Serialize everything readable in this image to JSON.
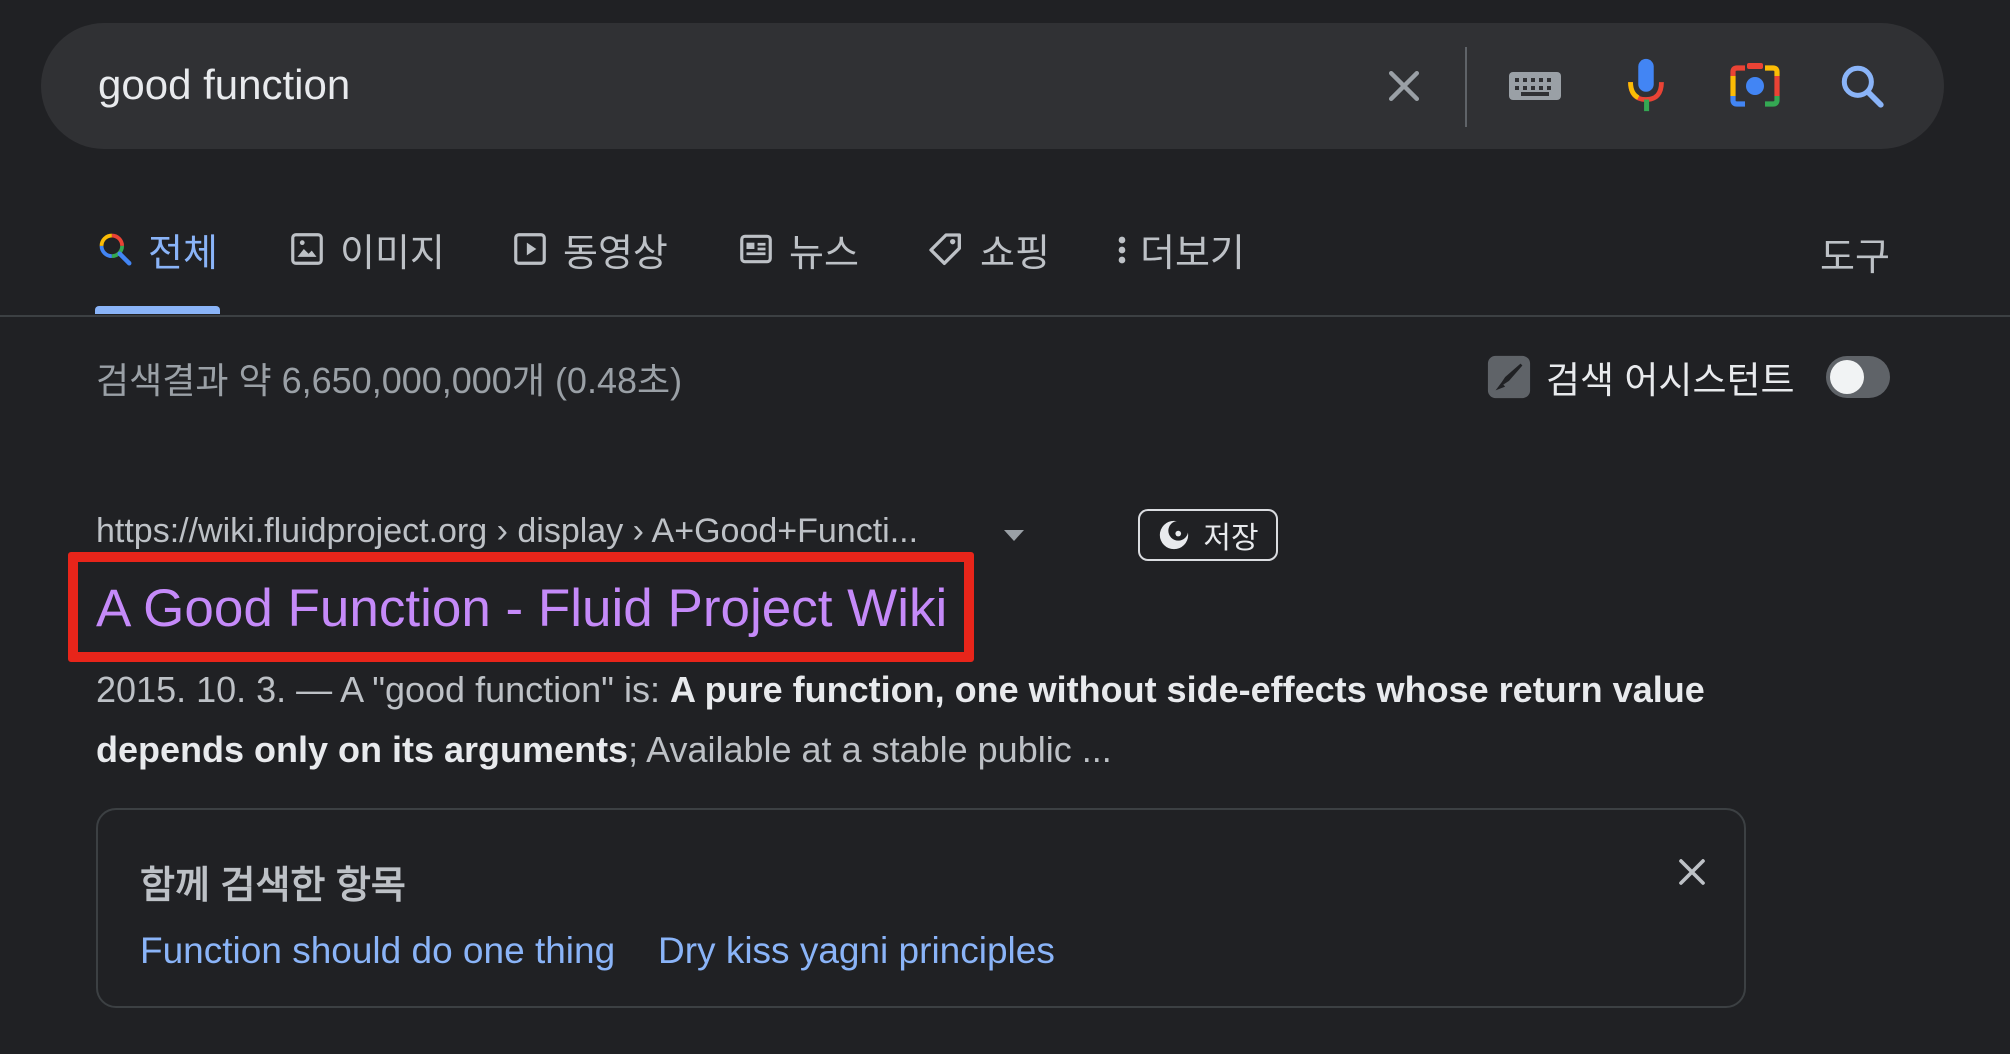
{
  "search": {
    "query": "good function"
  },
  "tabs": [
    {
      "label": "전체",
      "icon": "search-color-icon"
    },
    {
      "label": "이미지",
      "icon": "image-icon"
    },
    {
      "label": "동영상",
      "icon": "video-icon"
    },
    {
      "label": "뉴스",
      "icon": "news-icon"
    },
    {
      "label": "쇼핑",
      "icon": "tag-icon"
    },
    {
      "label": "더보기",
      "icon": "more-vert-icon"
    }
  ],
  "tools_label": "도구",
  "stats": "검색결과 약 6,650,000,000개 (0.48초)",
  "assistant": {
    "label": "검색 어시스턴트",
    "enabled": false
  },
  "result": {
    "breadcrumb": "https://wiki.fluidproject.org › display › A+Good+Functi...",
    "save_label": "저장",
    "title": "A Good Function - Fluid Project Wiki",
    "snippet_date": "2015. 10. 3. — A \"good function\" is: ",
    "snippet_bold": "A pure function, one without side-effects whose return value depends only on its arguments",
    "snippet_rest": "; Available at a stable public ..."
  },
  "related": {
    "title": "함께 검색한 항목",
    "links": [
      "Function should do one thing",
      "Dry kiss yagni principles"
    ]
  },
  "colors": {
    "background": "#202124",
    "visited_link": "#c58af9",
    "link": "#8ab4f8",
    "highlight": "#e8251a"
  }
}
